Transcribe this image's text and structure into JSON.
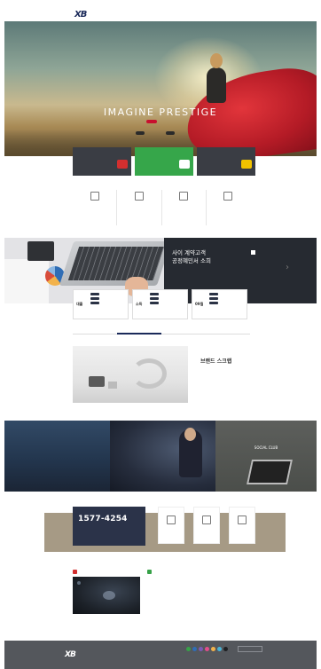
{
  "header": {
    "util_links": [
      "",
      "",
      "",
      ""
    ],
    "logo": {
      "mark": "XB",
      "sub": ""
    },
    "gnb": [
      "",
      "",
      "",
      "",
      "",
      ""
    ]
  },
  "hero": {
    "copy": "",
    "title": "IMAGINE PRESTIGE",
    "cta_primary": "",
    "cta_secondary": [
      "",
      ""
    ],
    "slide_count": 5
  },
  "cards3": [
    {
      "title": "",
      "desc": "",
      "color": "#3a3d44",
      "icon_color": "#d32f2f"
    },
    {
      "title": "",
      "desc": "",
      "color": "#36a64a",
      "icon_color": "#ffffff"
    },
    {
      "title": "",
      "desc": "",
      "color": "#3a3d44",
      "icon_color": "#f2c300"
    }
  ],
  "icon_menu": [
    {
      "label": "",
      "sub": "",
      "icon": "doc-icon"
    },
    {
      "label": "",
      "sub": "",
      "icon": "building-icon"
    },
    {
      "label": "",
      "sub": "",
      "icon": "mail-icon"
    },
    {
      "label": "",
      "sub": "",
      "icon": "pencil-icon"
    }
  ],
  "banking": {
    "title_line1": "사이 계약고객",
    "title_line2": "공정혜민서 소희",
    "desc": "",
    "rates": [
      {
        "key": "대출",
        "rows": [
          "",
          "",
          ""
        ]
      },
      {
        "key": "소득",
        "rows": [
          "",
          "",
          ""
        ]
      },
      {
        "key": "09월",
        "rows": [
          "",
          "",
          ""
        ]
      }
    ]
  },
  "tabs": [
    {
      "label": "",
      "active": false
    },
    {
      "label": "",
      "active": true
    },
    {
      "label": "",
      "active": false
    },
    {
      "label": "",
      "active": false
    }
  ],
  "brand": {
    "tag": "",
    "title": "브랜드 스크랩",
    "desc": "",
    "more": ""
  },
  "panels": [
    {
      "title": "",
      "desc": ""
    },
    {
      "title": "",
      "desc": ""
    },
    {
      "title": "SOCIAL CLUB",
      "desc": ""
    }
  ],
  "customer_center": {
    "label": "",
    "sub": "",
    "tel": "1577-4254",
    "hours": "",
    "cards": [
      {
        "label": "",
        "more": ""
      },
      {
        "label": "",
        "more": ""
      },
      {
        "label": "",
        "more": ""
      }
    ]
  },
  "video": {
    "title": "",
    "more": "",
    "clip_title": "",
    "clip_logo": ""
  },
  "notice": {
    "title": "",
    "more": "",
    "body": ""
  },
  "footer": {
    "logo": {
      "mark": "XB",
      "sub": ""
    },
    "text": "",
    "sns_colors": [
      "#37a148",
      "#2f6db5",
      "#7b5ab5",
      "#e34d8a",
      "#f2b24b",
      "#4ab3d4",
      "#1d1f22"
    ],
    "family_site": ""
  }
}
